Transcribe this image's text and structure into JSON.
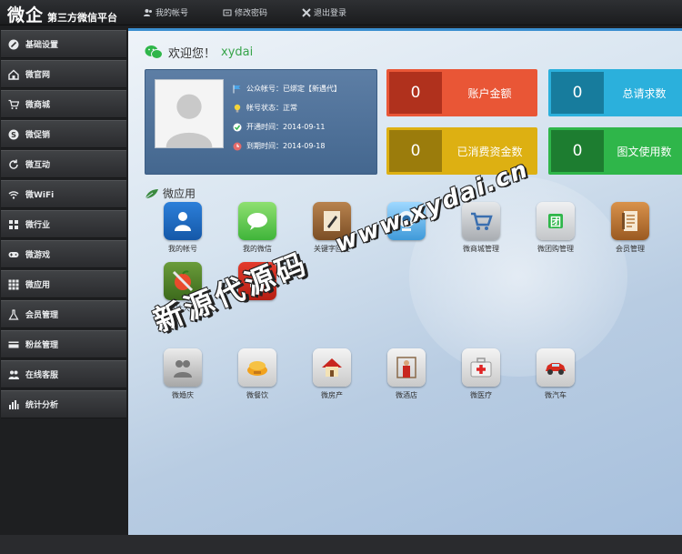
{
  "header": {
    "logo_main": "微企",
    "logo_sub": "第三方微信平台",
    "nav": [
      {
        "label": "我的帐号",
        "icon": "users-icon"
      },
      {
        "label": "修改密码",
        "icon": "password-icon"
      },
      {
        "label": "退出登录",
        "icon": "logout-icon"
      }
    ]
  },
  "sidebar": {
    "items": [
      {
        "label": "基础设置",
        "icon": "wrench-icon"
      },
      {
        "label": "微官网",
        "icon": "home-icon"
      },
      {
        "label": "微商城",
        "icon": "cart-icon"
      },
      {
        "label": "微促销",
        "icon": "skype-icon"
      },
      {
        "label": "微互动",
        "icon": "refresh-icon"
      },
      {
        "label": "微WiFi",
        "icon": "wifi-icon"
      },
      {
        "label": "微行业",
        "icon": "grid-icon"
      },
      {
        "label": "微游戏",
        "icon": "gamepad-icon"
      },
      {
        "label": "微应用",
        "icon": "apps-icon"
      },
      {
        "label": "会员管理",
        "icon": "flask-icon"
      },
      {
        "label": "粉丝管理",
        "icon": "card-icon"
      },
      {
        "label": "在线客服",
        "icon": "support-icon"
      },
      {
        "label": "统计分析",
        "icon": "chart-icon"
      }
    ]
  },
  "welcome": {
    "prefix": "欢迎您！",
    "username": "xydai"
  },
  "profile": {
    "rows": [
      {
        "text": "公众帐号：已绑定【新遇代】",
        "icon": "flag-icon"
      },
      {
        "text": "帐号状态：正常",
        "icon": "bulb-icon"
      },
      {
        "text": "开通时间：2014-09-11",
        "icon": "check-icon"
      },
      {
        "text": "到期时间：2014-09-18",
        "icon": "clock-icon"
      }
    ]
  },
  "stats": [
    {
      "value": "0",
      "label": "账户金额"
    },
    {
      "value": "0",
      "label": "总请求数"
    },
    {
      "value": "0",
      "label": "已消费资金数"
    },
    {
      "value": "0",
      "label": "图文使用数"
    }
  ],
  "sections": {
    "apps_title": "微应用"
  },
  "apps_row1": [
    {
      "label": "我的帐号"
    },
    {
      "label": "我的微信"
    },
    {
      "label": "关键字回复"
    },
    {
      "label": ""
    },
    {
      "label": "微商城管理"
    },
    {
      "label": "微团购管理"
    },
    {
      "label": "会员管理"
    }
  ],
  "apps_row2": [
    {
      "label": "水果达人管理"
    },
    {
      "label": ""
    }
  ],
  "apps_row3": [
    {
      "label": "微婚庆"
    },
    {
      "label": "微餐饮"
    },
    {
      "label": "微房产"
    },
    {
      "label": "微酒店"
    },
    {
      "label": "微医疗"
    },
    {
      "label": "微汽车"
    }
  ],
  "watermark": {
    "url": "www.xydai.cn",
    "text": "新源代源码"
  },
  "colors": {
    "accent": "#3a8ed0",
    "username": "#37a44a"
  }
}
